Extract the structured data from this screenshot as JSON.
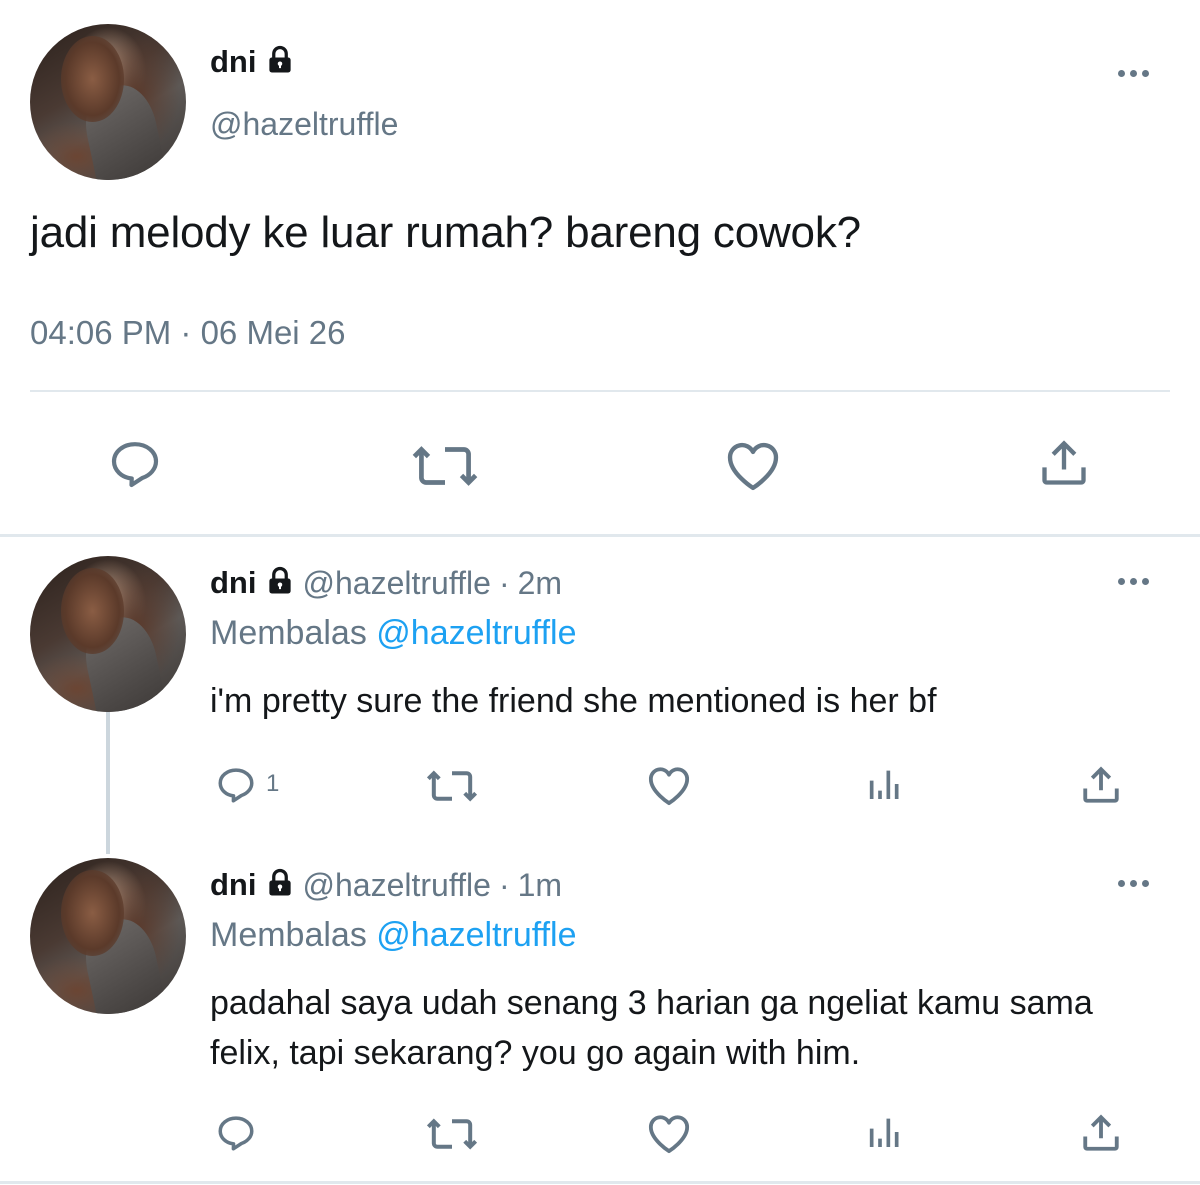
{
  "main_tweet": {
    "display_name": "dni",
    "handle": "@hazeltruffle",
    "text": "jadi melody ke luar rumah? bareng cowok?",
    "timestamp": "04:06 PM · 06 Mei 26",
    "actions": [
      "reply-icon",
      "retweet-icon",
      "like-icon",
      "share-icon"
    ]
  },
  "replies": [
    {
      "display_name": "dni",
      "handle": "@hazeltruffle",
      "time_sep": "·",
      "time": "2m",
      "replying_prefix": "Membalas",
      "replying_to": "@hazeltruffle",
      "text": "i'm pretty sure the friend she mentioned is her bf",
      "reply_count": "1"
    },
    {
      "display_name": "dni",
      "handle": "@hazeltruffle",
      "time_sep": "·",
      "time": "1m",
      "replying_prefix": "Membalas",
      "replying_to": "@hazeltruffle",
      "text_line1": "padahal saya udah senang 3 harian ga ngeliat kamu sama",
      "text_line2": "felix, tapi sekarang? you go again with him.",
      "reply_count": ""
    }
  ],
  "colors": {
    "text": "#14171a",
    "secondary": "#657786",
    "accent": "#1da1f2",
    "divider": "#e1e8ed",
    "thread_line": "#ccd6dd"
  }
}
